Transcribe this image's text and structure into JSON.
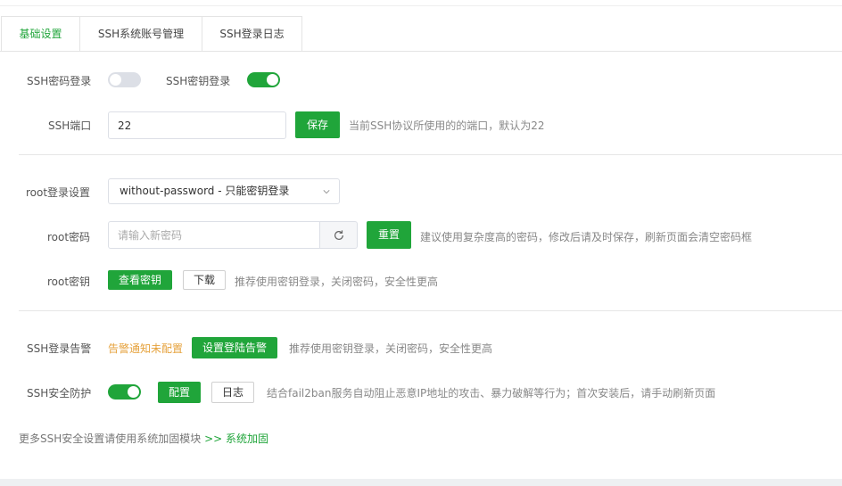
{
  "tabs": [
    {
      "label": "基础设置",
      "active": true
    },
    {
      "label": "SSH系统账号管理",
      "active": false
    },
    {
      "label": "SSH登录日志",
      "active": false
    }
  ],
  "ssh_password_login": {
    "label": "SSH密码登录",
    "enabled": false
  },
  "ssh_key_login": {
    "label": "SSH密钥登录",
    "enabled": true
  },
  "ssh_port": {
    "label": "SSH端口",
    "value": "22",
    "save_label": "保存",
    "hint": "当前SSH协议所使用的的端口，默认为22"
  },
  "root_login": {
    "label": "root登录设置",
    "selected": "without-password - 只能密钥登录"
  },
  "root_password": {
    "label": "root密码",
    "placeholder": "请输入新密码",
    "refresh_icon": "refresh-icon",
    "reset_label": "重置",
    "hint": "建议使用复杂度高的密码，修改后请及时保存，刷新页面会清空密码框"
  },
  "root_key": {
    "label": "root密钥",
    "view_label": "查看密钥",
    "download_label": "下载",
    "hint": "推荐使用密钥登录，关闭密码，安全性更高"
  },
  "ssh_alert": {
    "label": "SSH登录告警",
    "status": "告警通知未配置",
    "button_label": "设置登陆告警",
    "hint": "推荐使用密钥登录，关闭密码，安全性更高"
  },
  "ssh_protect": {
    "label": "SSH安全防护",
    "enabled": true,
    "config_label": "配置",
    "log_label": "日志",
    "hint": "结合fail2ban服务自动阻止恶意IP地址的攻击、暴力破解等行为；首次安装后，请手动刷新页面"
  },
  "footer": {
    "text": "更多SSH安全设置请使用系统加固模块",
    "link": ">> 系统加固"
  },
  "colors": {
    "accent": "#20a53a",
    "warning": "#e6a23c"
  }
}
